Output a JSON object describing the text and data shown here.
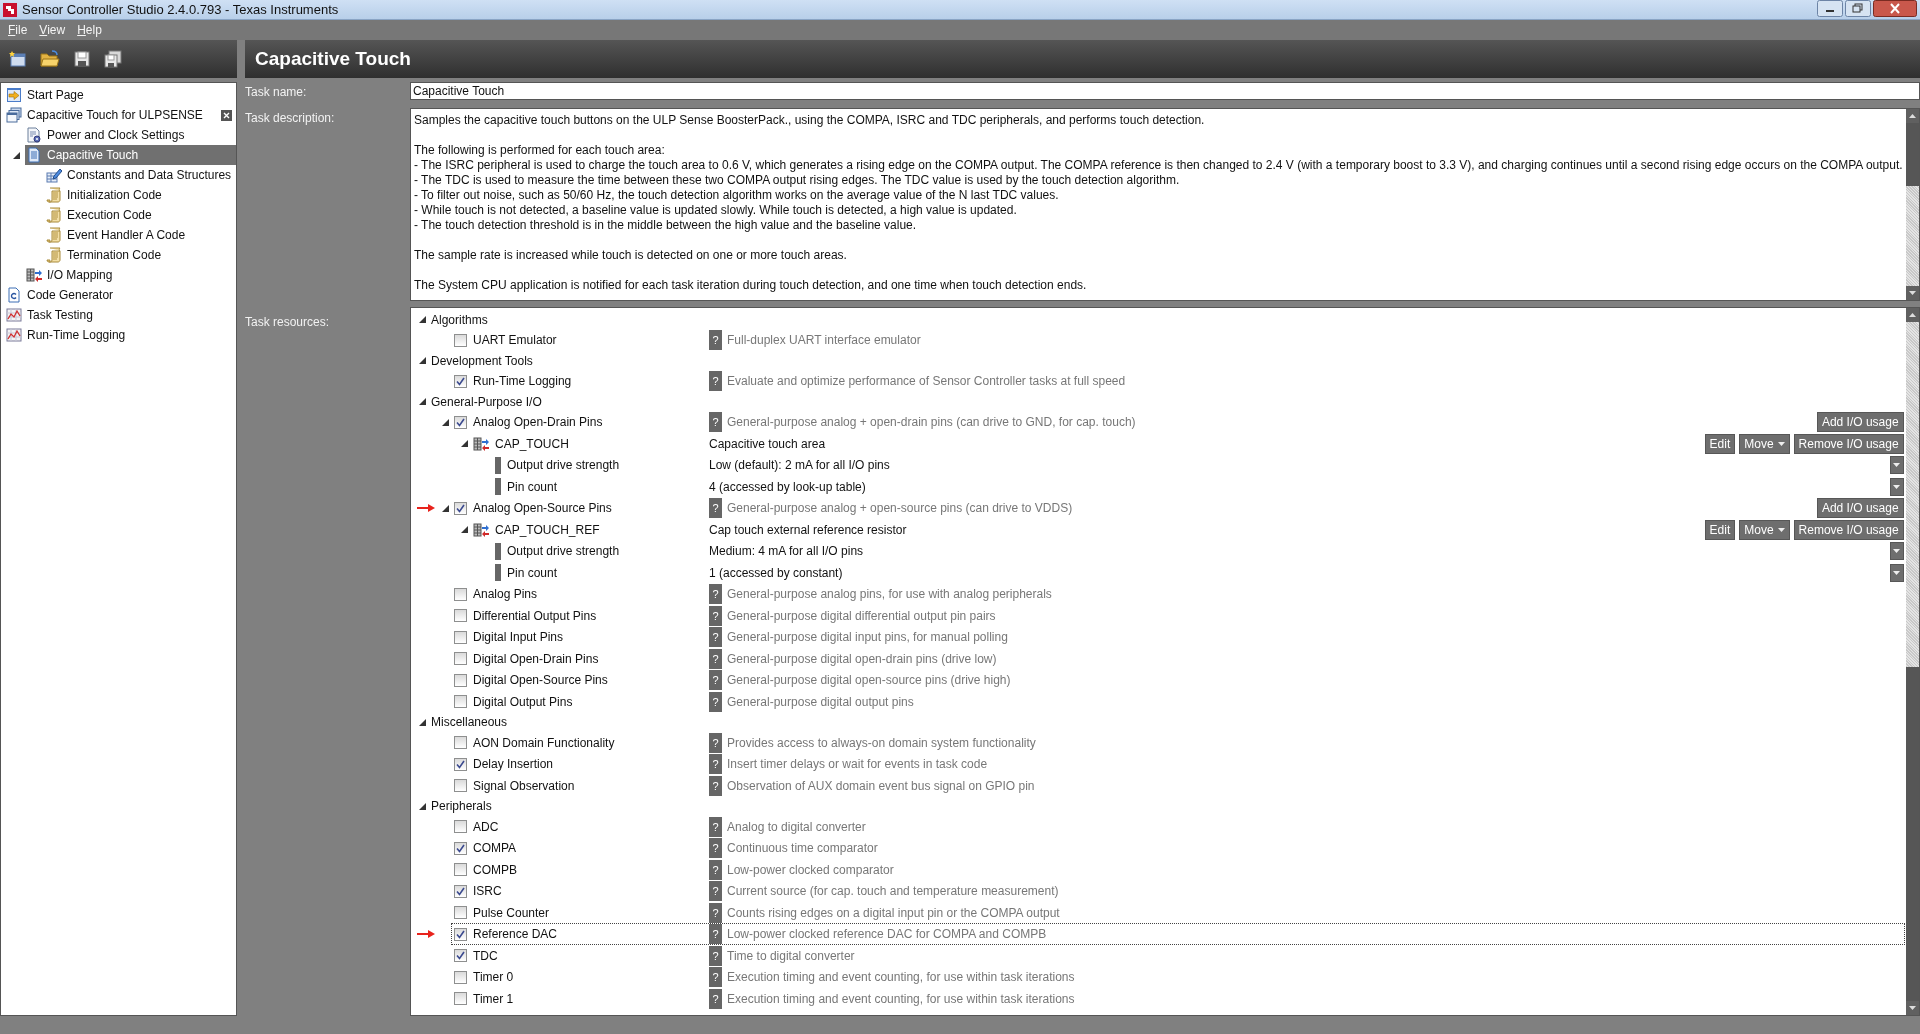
{
  "window": {
    "title": "Sensor Controller Studio 2.4.0.793 - Texas Instruments"
  },
  "menu": [
    "File",
    "View",
    "Help"
  ],
  "sidebar": {
    "items": [
      {
        "kind": "start",
        "label": "Start Page",
        "selected": false
      },
      {
        "kind": "project",
        "label": "Capacitive Touch for ULPSENSE",
        "selected": false,
        "closable": true,
        "children": [
          {
            "kind": "settings",
            "label": "Power and Clock Settings",
            "selected": false
          },
          {
            "kind": "task",
            "label": "Capacitive Touch",
            "selected": true,
            "expanded": true,
            "children": [
              {
                "kind": "constants",
                "label": "Constants and Data Structures",
                "selected": false
              },
              {
                "kind": "code",
                "label": "Initialization Code",
                "selected": false
              },
              {
                "kind": "code",
                "label": "Execution Code",
                "selected": false
              },
              {
                "kind": "code",
                "label": "Event Handler A Code",
                "selected": false
              },
              {
                "kind": "code",
                "label": "Termination Code",
                "selected": false
              }
            ]
          },
          {
            "kind": "mapping",
            "label": "I/O Mapping",
            "selected": false
          }
        ]
      },
      {
        "kind": "generator",
        "label": "Code Generator",
        "selected": false
      },
      {
        "kind": "testing",
        "label": "Task Testing",
        "selected": false
      },
      {
        "kind": "testing",
        "label": "Run-Time Logging",
        "selected": false
      }
    ]
  },
  "page_title": "Capacitive Touch",
  "task_name": {
    "label": "Task name:",
    "value": "Capacitive Touch"
  },
  "task_description": {
    "label": "Task description:",
    "paragraphs": [
      [
        "Samples the capacitive touch buttons on the ULP Sense BoosterPack., using the COMPA, ISRC and TDC peripherals, and performs touch detection."
      ],
      [
        "The following is performed for each touch area:",
        "- The ISRC peripheral is used to charge the touch area to 0.6 V, which generates a rising edge on the COMPA output. The COMPA reference is then changed to 2.4 V (with a temporary boost to 3.3 V), and charging continues until a second rising edge occurs on the COMPA output.",
        "- The TDC is used to measure the time between these two COMPA output rising edges. The TDC value is used by the touch detection algorithm.",
        "- To filter out noise, such as 50/60 Hz, the touch detection algorithm works on the average value of the N last TDC values.",
        "- While touch is not detected, a baseline value is updated slowly. While touch is detected, a high value is updated.",
        "- The touch detection threshold is in the middle between the high value and the baseline value."
      ],
      [
        "The sample rate is increased while touch is detected on one or more touch areas."
      ],
      [
        "The System CPU application is notified for each task iteration during touch detection, and one time when touch detection ends."
      ]
    ]
  },
  "task_resources": {
    "label": "Task resources:",
    "groups": [
      {
        "label": "Algorithms",
        "expanded": true,
        "items": [
          {
            "kind": "resource",
            "label": "UART Emulator",
            "checked": false,
            "selected": false,
            "marked": false,
            "help": "?",
            "description": "Full-duplex UART interface emulator"
          }
        ]
      },
      {
        "label": "Development Tools",
        "expanded": true,
        "items": [
          {
            "kind": "resource",
            "label": "Run-Time Logging",
            "checked": true,
            "selected": false,
            "marked": false,
            "help": "?",
            "description": "Evaluate and optimize performance of Sensor Controller tasks at full speed"
          }
        ]
      },
      {
        "label": "General-Purpose I/O",
        "expanded": true,
        "items": [
          {
            "kind": "resource",
            "label": "Analog Open-Drain Pins",
            "checked": true,
            "selected": false,
            "marked": false,
            "expanded": true,
            "help": "?",
            "description": "General-purpose analog + open-drain pins (can drive to GND, for cap. touch)",
            "action": "Add I/O usage",
            "children": [
              {
                "kind": "io",
                "label": "CAP_TOUCH",
                "value": "Capacitive touch area",
                "selected": false,
                "expanded": true,
                "buttons": [
                  {
                    "label": "Edit",
                    "menu": false
                  },
                  {
                    "label": "Move",
                    "menu": true
                  },
                  {
                    "label": "Remove I/O usage",
                    "menu": false
                  }
                ],
                "children": [
                  {
                    "kind": "setting",
                    "label": "Output drive strength",
                    "value": "Low (default): 2 mA for all I/O pins",
                    "selected": false
                  },
                  {
                    "kind": "setting",
                    "label": "Pin count",
                    "value": "4 (accessed by look-up table)",
                    "selected": false
                  }
                ]
              }
            ]
          },
          {
            "kind": "resource",
            "label": "Analog Open-Source Pins",
            "checked": true,
            "selected": false,
            "marked": true,
            "expanded": true,
            "help": "?",
            "description": "General-purpose analog + open-source pins (can drive to VDDS)",
            "action": "Add I/O usage",
            "children": [
              {
                "kind": "io",
                "label": "CAP_TOUCH_REF",
                "value": "Cap touch external reference resistor",
                "selected": false,
                "expanded": true,
                "buttons": [
                  {
                    "label": "Edit",
                    "menu": false
                  },
                  {
                    "label": "Move",
                    "menu": true
                  },
                  {
                    "label": "Remove I/O usage",
                    "menu": false
                  }
                ],
                "children": [
                  {
                    "kind": "setting",
                    "label": "Output drive strength",
                    "value": "Medium: 4 mA for all I/O pins",
                    "selected": false
                  },
                  {
                    "kind": "setting",
                    "label": "Pin count",
                    "value": "1 (accessed by constant)",
                    "selected": false
                  }
                ]
              }
            ]
          },
          {
            "kind": "resource",
            "label": "Analog Pins",
            "checked": false,
            "selected": false,
            "marked": false,
            "help": "?",
            "description": "General-purpose analog pins, for use with analog peripherals"
          },
          {
            "kind": "resource",
            "label": "Differential Output Pins",
            "checked": false,
            "selected": false,
            "marked": false,
            "help": "?",
            "description": "General-purpose digital differential output pin pairs"
          },
          {
            "kind": "resource",
            "label": "Digital Input Pins",
            "checked": false,
            "selected": false,
            "marked": false,
            "help": "?",
            "description": "General-purpose digital input pins, for manual polling"
          },
          {
            "kind": "resource",
            "label": "Digital Open-Drain Pins",
            "checked": false,
            "selected": false,
            "marked": false,
            "help": "?",
            "description": "General-purpose digital open-drain pins (drive low)"
          },
          {
            "kind": "resource",
            "label": "Digital Open-Source Pins",
            "checked": false,
            "selected": false,
            "marked": false,
            "help": "?",
            "description": "General-purpose digital open-source pins (drive high)"
          },
          {
            "kind": "resource",
            "label": "Digital Output Pins",
            "checked": false,
            "selected": false,
            "marked": false,
            "help": "?",
            "description": "General-purpose digital output pins"
          }
        ]
      },
      {
        "label": "Miscellaneous",
        "expanded": true,
        "items": [
          {
            "kind": "resource",
            "label": "AON Domain Functionality",
            "checked": false,
            "selected": false,
            "marked": false,
            "help": "?",
            "description": "Provides access to always-on domain system functionality"
          },
          {
            "kind": "resource",
            "label": "Delay Insertion",
            "checked": true,
            "selected": false,
            "marked": false,
            "help": "?",
            "description": "Insert timer delays or wait for events in task code"
          },
          {
            "kind": "resource",
            "label": "Signal Observation",
            "checked": false,
            "selected": false,
            "marked": false,
            "help": "?",
            "description": "Observation of AUX domain event bus signal on GPIO pin"
          }
        ]
      },
      {
        "label": "Peripherals",
        "expanded": true,
        "items": [
          {
            "kind": "resource",
            "label": "ADC",
            "checked": false,
            "selected": false,
            "marked": false,
            "help": "?",
            "description": "Analog to digital converter"
          },
          {
            "kind": "resource",
            "label": "COMPA",
            "checked": true,
            "selected": false,
            "marked": false,
            "help": "?",
            "description": "Continuous time comparator"
          },
          {
            "kind": "resource",
            "label": "COMPB",
            "checked": false,
            "selected": false,
            "marked": false,
            "help": "?",
            "description": "Low-power clocked comparator"
          },
          {
            "kind": "resource",
            "label": "ISRC",
            "checked": true,
            "selected": false,
            "marked": false,
            "help": "?",
            "description": "Current source (for cap. touch and temperature measurement)"
          },
          {
            "kind": "resource",
            "label": "Pulse Counter",
            "checked": false,
            "selected": false,
            "marked": false,
            "help": "?",
            "description": "Counts rising edges on a digital input pin or the COMPA output"
          },
          {
            "kind": "resource",
            "label": "Reference DAC",
            "checked": true,
            "selected": true,
            "marked": true,
            "help": "?",
            "description": "Low-power clocked reference DAC for COMPA and COMPB"
          },
          {
            "kind": "resource",
            "label": "TDC",
            "checked": true,
            "selected": false,
            "marked": false,
            "help": "?",
            "description": "Time to digital converter"
          },
          {
            "kind": "resource",
            "label": "Timer 0",
            "checked": false,
            "selected": false,
            "marked": false,
            "help": "?",
            "description": "Execution timing and event counting, for use within task iterations"
          },
          {
            "kind": "resource",
            "label": "Timer 1",
            "checked": false,
            "selected": false,
            "marked": false,
            "help": "?",
            "description": "Execution timing and event counting, for use within task iterations"
          }
        ]
      }
    ]
  }
}
